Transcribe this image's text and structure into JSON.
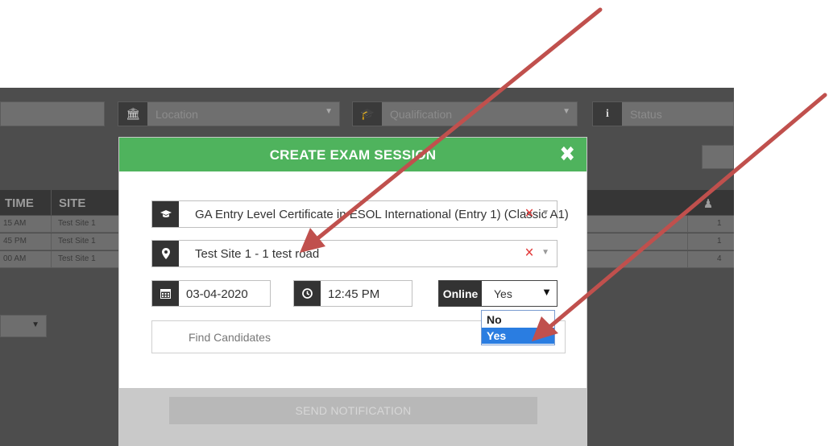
{
  "background": {
    "filters": {
      "location": {
        "placeholder": "Location"
      },
      "qualification": {
        "placeholder": "Qualification"
      },
      "status": {
        "placeholder": "Status"
      }
    },
    "table": {
      "headers": {
        "time": "TIME",
        "site": "SITE"
      },
      "rows": [
        {
          "time": "15 AM",
          "site": "Test Site 1",
          "count": "1"
        },
        {
          "time": "45 PM",
          "site": "Test Site 1",
          "count": "1"
        },
        {
          "time": "00 AM",
          "site": "Test Site 1",
          "count": "4"
        }
      ]
    }
  },
  "modal": {
    "title": "CREATE EXAM SESSION",
    "qualification": "GA Entry Level Certificate in ESOL International (Entry 1) (Classic A1)",
    "location": "Test Site 1 - 1 test road",
    "date": "03-04-2020",
    "time": "12:45 PM",
    "online": {
      "label": "Online",
      "value": "Yes",
      "options": [
        "No",
        "Yes"
      ]
    },
    "candidates_placeholder": "Find Candidates",
    "send_label": "SEND NOTIFICATION"
  },
  "colors": {
    "header_green": "#4fb35d",
    "selected_option": "#2a7de1",
    "clear_red": "#e23b3b",
    "arrow_red": "#c0504d"
  }
}
